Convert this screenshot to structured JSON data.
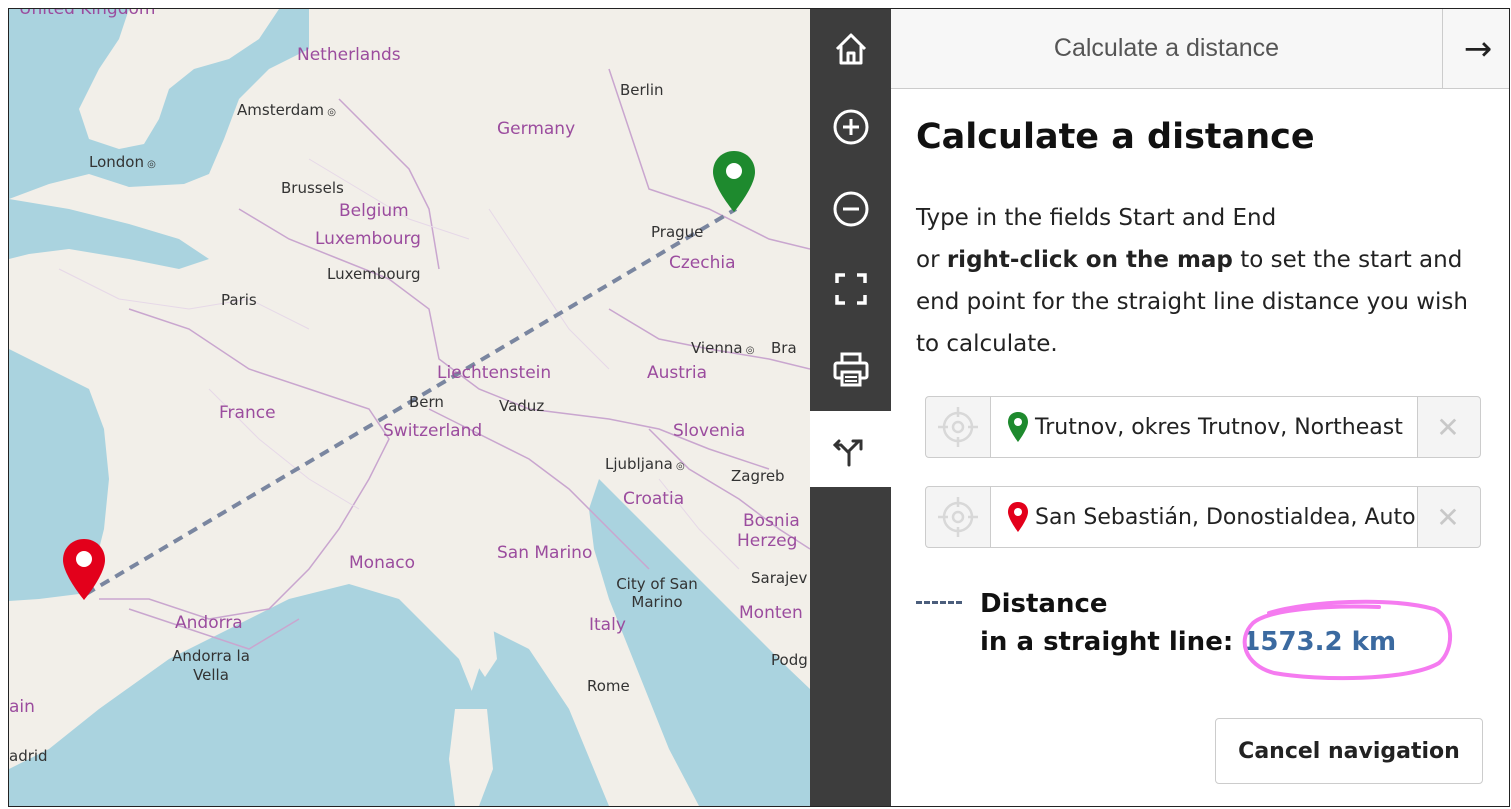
{
  "map": {
    "labels": {
      "united_kingdom": "United Kingdom",
      "netherlands": "Netherlands",
      "amsterdam": "Amsterdam",
      "berlin": "Berlin",
      "germany": "Germany",
      "london": "London",
      "brussels": "Brussels",
      "belgium": "Belgium",
      "luxembourg_country": "Luxembourg",
      "luxembourg_city": "Luxembourg",
      "prague": "Prague",
      "czechia": "Czechia",
      "paris": "Paris",
      "vienna": "Vienna",
      "bratislava_partial": "Bra",
      "liechtenstein": "Liechtenstein",
      "austria": "Austria",
      "france": "France",
      "bern": "Bern",
      "vaduz": "Vaduz",
      "switzerland": "Switzerland",
      "slovenia": "Slovenia",
      "ljubljana": "Ljubljana",
      "zagreb": "Zagreb",
      "croatia": "Croatia",
      "bosnia": "Bosnia",
      "herzeg": "Herzeg",
      "monaco": "Monaco",
      "san_marino": "San Marino",
      "sarajevo": "Sarajev",
      "city_of_san_marino": "City of San Marino",
      "montenegro_partial": "Monten",
      "andorra": "Andorra",
      "andorra_la_vella": "Andorra la Vella",
      "italy": "Italy",
      "podgorica_partial": "Podg",
      "rome": "Rome",
      "spain_partial": "ain",
      "madrid_partial": "adrid"
    },
    "start_pin_color": "#1e8a2e",
    "end_pin_color": "#e3001b",
    "route_color": "#7a86a0"
  },
  "toolbar": {
    "buttons": [
      "home-icon",
      "zoom-in-icon",
      "zoom-out-icon",
      "fullscreen-icon",
      "print-icon",
      "route-icon"
    ]
  },
  "panel": {
    "header_title": "Calculate a distance",
    "heading": "Calculate a distance",
    "desc_line1": "Type in the fields Start and End",
    "desc_or": "or ",
    "desc_bold": "right-click on the map",
    "desc_rest": " to set the start and end point for the straight line distance you wish to calculate.",
    "start_value": "Trutnov, okres Trutnov, Northeast",
    "end_value": "San Sebastián, Donostialdea, Autonomous",
    "distance_label_1": "Distance",
    "distance_label_2": "in a straight line: ",
    "distance_value": "1573.2 km",
    "cancel_label": "Cancel navigation",
    "accent_color": "#3b6aa0",
    "highlight_color": "#f57bf0"
  }
}
